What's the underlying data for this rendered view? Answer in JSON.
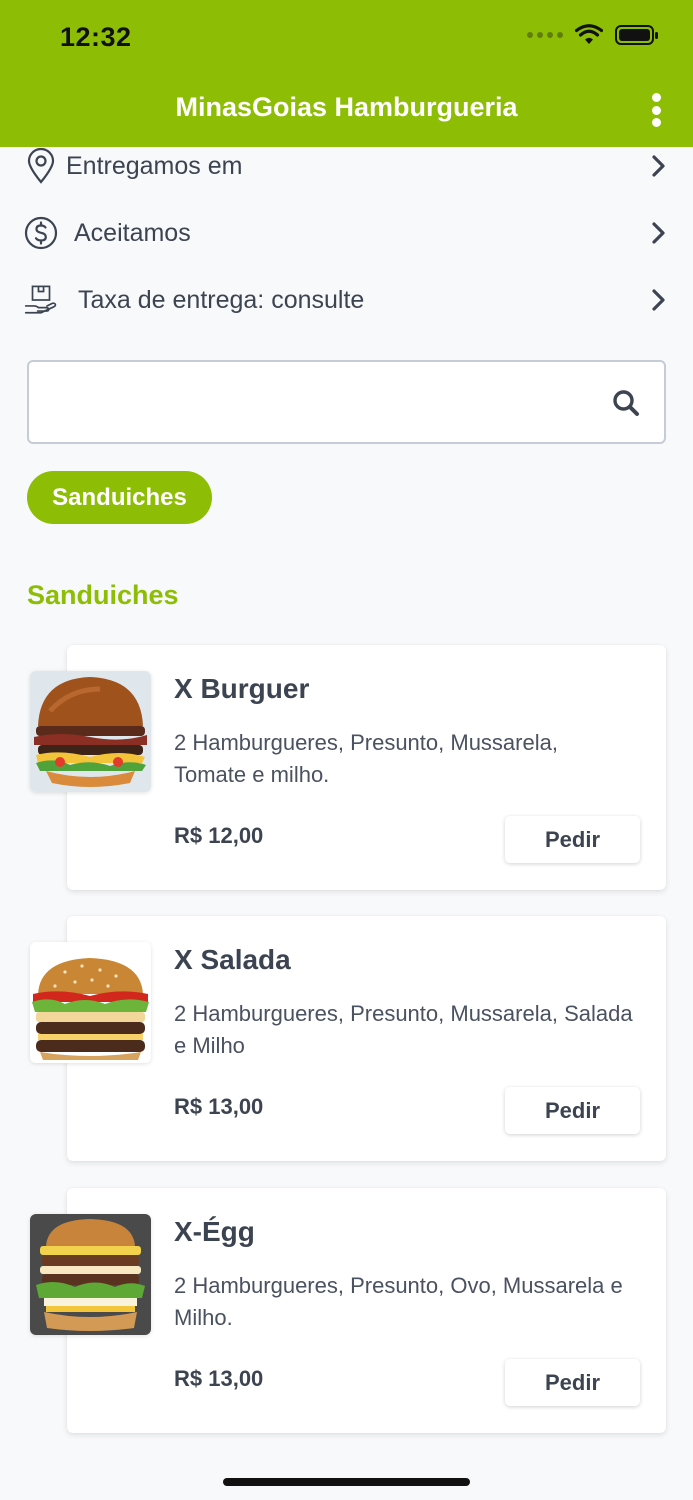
{
  "status_bar": {
    "time": "12:32"
  },
  "header": {
    "title": "MinasGoias Hamburgueria"
  },
  "info": {
    "delivery_area": "Entregamos em",
    "payment": "Aceitamos",
    "delivery_fee": "Taxa de entrega: consulte"
  },
  "search": {
    "value": "",
    "placeholder": ""
  },
  "categories": [
    {
      "label": "Sanduiches"
    }
  ],
  "section": {
    "title": "Sanduiches"
  },
  "products": [
    {
      "name": "X Burguer",
      "description": "2 Hamburgueres, Presunto, Mussarela, Tomate e milho.",
      "price": "R$ 12,00",
      "button": "Pedir"
    },
    {
      "name": "X Salada",
      "description": "2 Hamburgueres, Presunto, Mussarela, Salada e Milho",
      "price": "R$ 13,00",
      "button": "Pedir"
    },
    {
      "name": "X-Égg",
      "description": "2 Hamburgueres, Presunto, Ovo, Mussarela e Milho.",
      "price": "R$ 13,00",
      "button": "Pedir"
    }
  ],
  "colors": {
    "brand": "#8ebd06",
    "text": "#3d4451",
    "background": "#f8f9fa"
  },
  "icons": [
    "location-pin-icon",
    "dollar-circle-icon",
    "delivery-box-icon",
    "chevron-right-icon",
    "search-icon",
    "more-vertical-icon"
  ]
}
